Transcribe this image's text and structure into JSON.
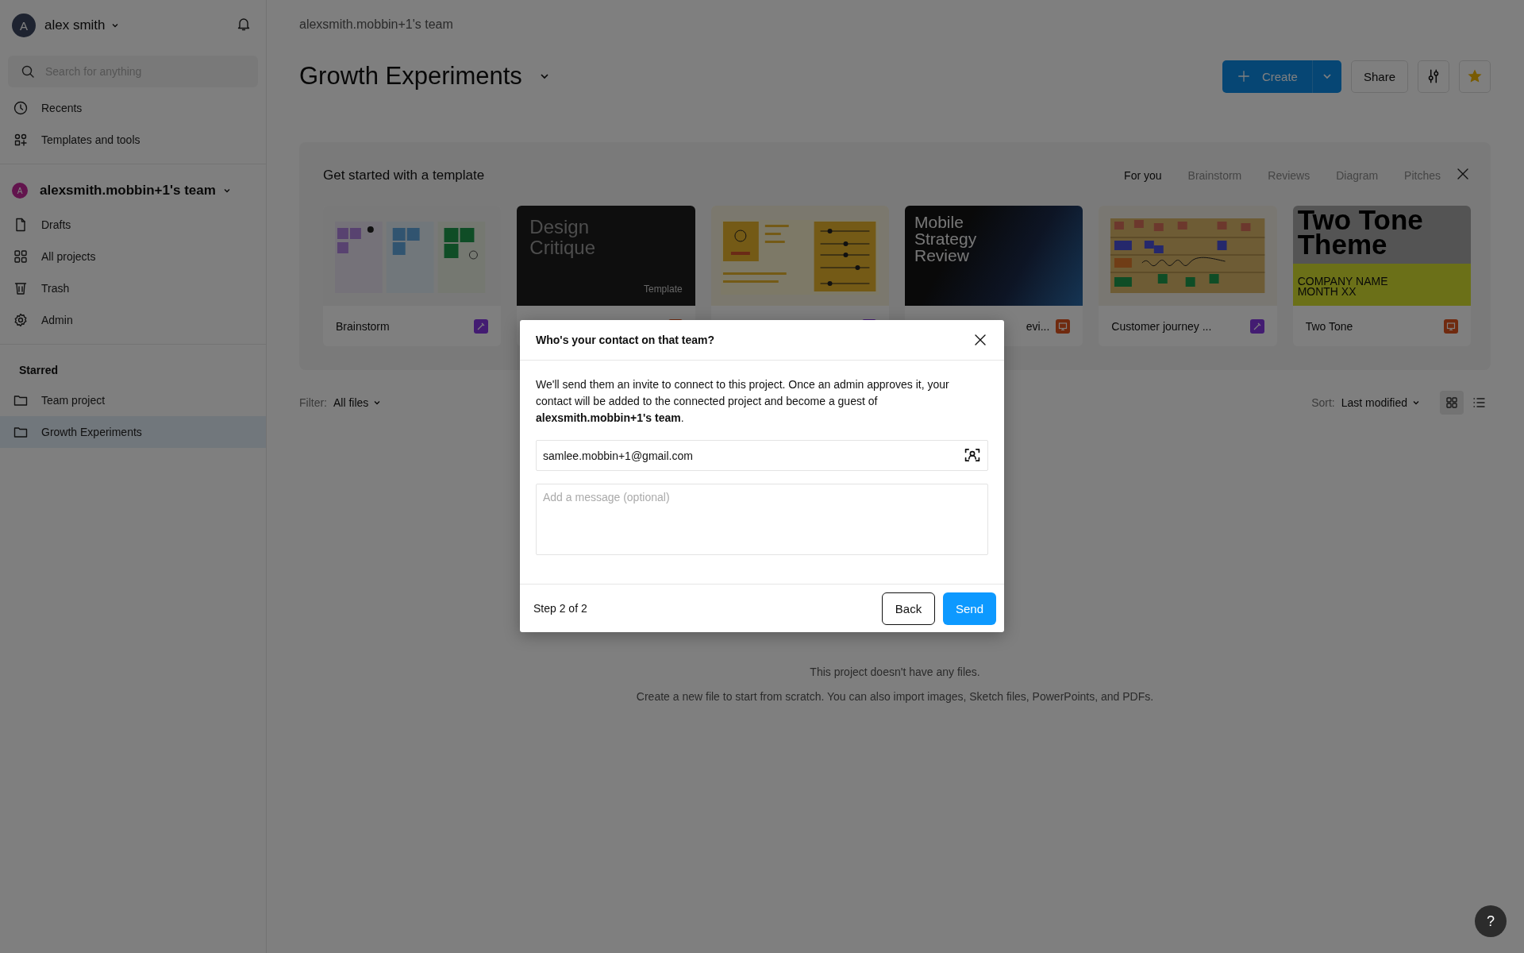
{
  "sidebar": {
    "user": {
      "initial": "A",
      "name": "alex smith"
    },
    "search": {
      "placeholder": "Search for anything"
    },
    "nav": [
      {
        "label": "Recents",
        "selected": false
      },
      {
        "label": "Templates and tools",
        "selected": false
      }
    ],
    "team": {
      "initial": "A",
      "name": "alexsmith.mobbin+1's team"
    },
    "team_nav": [
      {
        "label": "Drafts",
        "selected": false
      },
      {
        "label": "All projects",
        "selected": false
      },
      {
        "label": "Trash",
        "selected": false
      },
      {
        "label": "Admin",
        "selected": false
      }
    ],
    "starred": {
      "heading": "Starred",
      "items": [
        {
          "label": "Team project",
          "selected": false
        },
        {
          "label": "Growth Experiments",
          "selected": true
        }
      ]
    }
  },
  "header": {
    "breadcrumb": "alexsmith.mobbin+1's team",
    "title": "Growth Experiments",
    "create_button": "Create",
    "share_button": "Share",
    "starred": true
  },
  "templates": {
    "title": "Get started with a template",
    "tabs": [
      {
        "label": "For you",
        "selected": true
      },
      {
        "label": "Brainstorm",
        "selected": false
      },
      {
        "label": "Reviews",
        "selected": false
      },
      {
        "label": "Diagram",
        "selected": false
      },
      {
        "label": "Pitches",
        "selected": false
      }
    ],
    "cards": [
      {
        "kind": "figjam",
        "thumbnail": {
          "kind": "stickies"
        },
        "label": "Brainstorm"
      },
      {
        "kind": "slides",
        "thumbnail": {
          "kind": "dark-title",
          "title": "Design Critique",
          "caption": "Template"
        }
      },
      {
        "kind": "figjam",
        "thumbnail": {
          "kind": "profile"
        }
      },
      {
        "kind": "slides",
        "thumbnail": {
          "kind": "gradient-title",
          "title": "Mobile Strategy Review"
        },
        "label": "evi...",
        "clipped": true
      },
      {
        "kind": "figjam",
        "thumbnail": {
          "kind": "journey"
        },
        "label": "Customer journey ..."
      },
      {
        "kind": "slides",
        "thumbnail": {
          "kind": "two-tone",
          "title": "Two Tone Theme",
          "lines": [
            "COMPANY NAME",
            "MONTH XX"
          ]
        },
        "label": "Two Tone"
      }
    ]
  },
  "filter": {
    "label": "Filter:",
    "value": "All files"
  },
  "sort": {
    "label": "Sort:",
    "value": "Last modified"
  },
  "view_modes": [
    {
      "selected": true
    },
    {
      "selected": false
    }
  ],
  "empty_state": {
    "title": "This project doesn't have any files.",
    "description": "Create a new file to start from scratch. You can also import images, Sketch files, PowerPoints, and PDFs."
  },
  "dialog": {
    "title": "Who's your contact on that team?",
    "body": "We'll send them an invite to connect to this project. Once an admin approves it, your contact will be added to the connected project and become a guest of **alexsmith.mobbin+1's team**.",
    "email": {
      "value": "samlee.mobbin+1@gmail.com"
    },
    "message": {
      "placeholder": "Add a message (optional)"
    },
    "step": "Step 2 of 2",
    "back_button": "Back",
    "send_button": "Send"
  },
  "help_button": "?"
}
